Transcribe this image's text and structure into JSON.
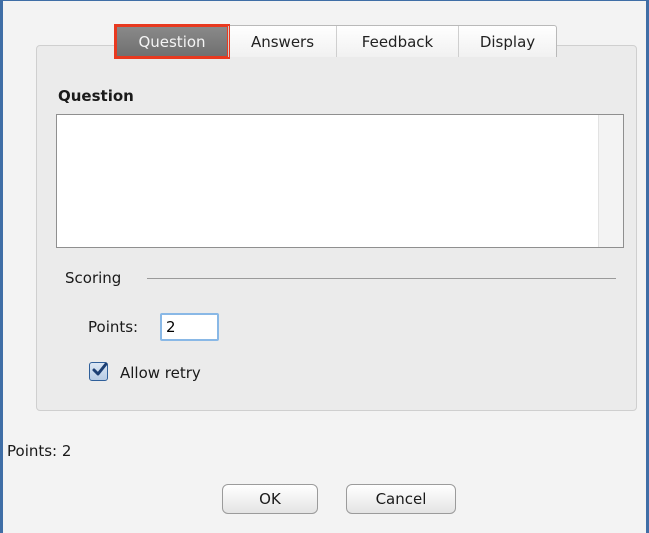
{
  "tabs": [
    {
      "label": "Question",
      "active": true
    },
    {
      "label": "Answers",
      "active": false
    },
    {
      "label": "Feedback",
      "active": false
    },
    {
      "label": "Display",
      "active": false
    }
  ],
  "question": {
    "heading": "Question",
    "text": ""
  },
  "scoring": {
    "legend": "Scoring",
    "points_label": "Points:",
    "points_value": "2",
    "allow_retry_label": "Allow retry",
    "allow_retry_checked": true
  },
  "summary": "Points: 2",
  "buttons": {
    "ok": "OK",
    "cancel": "Cancel"
  },
  "colors": {
    "highlight": "#e8391f",
    "window_border": "#3f6ea6",
    "focus": "#89b8e6"
  }
}
